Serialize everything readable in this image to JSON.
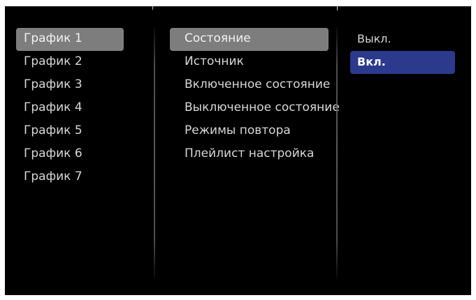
{
  "schedules": {
    "items": [
      {
        "label": "График 1",
        "selected": true
      },
      {
        "label": "График 2"
      },
      {
        "label": "График 3"
      },
      {
        "label": "График 4"
      },
      {
        "label": "График 5"
      },
      {
        "label": "График 6"
      },
      {
        "label": "График 7"
      }
    ]
  },
  "settings": {
    "items": [
      {
        "label": "Состояние",
        "selected": true
      },
      {
        "label": "Источник"
      },
      {
        "label": "Включенное состояние"
      },
      {
        "label": "Выключенное состояние"
      },
      {
        "label": "Режимы повтора"
      },
      {
        "label": "Плейлист настройка"
      }
    ]
  },
  "options": {
    "items": [
      {
        "label": "Выкл."
      },
      {
        "label": "Вкл.",
        "focused": true
      }
    ]
  },
  "colors": {
    "background": "#000000",
    "selected_highlight": "#7d7d7d",
    "focus_highlight": "#2b3a8c",
    "text": "#d7d7d7"
  }
}
